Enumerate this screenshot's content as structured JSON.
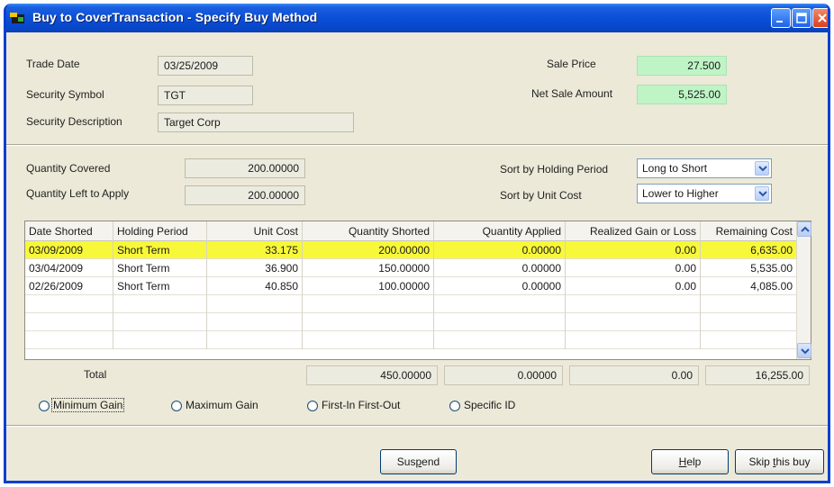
{
  "window": {
    "title": "Buy to CoverTransaction - Specify Buy Method"
  },
  "trade": {
    "trade_date_label": "Trade Date",
    "trade_date": "03/25/2009",
    "symbol_label": "Security Symbol",
    "symbol": "TGT",
    "description_label": "Security Description",
    "description": "Target Corp",
    "sale_price_label": "Sale Price",
    "sale_price": "27.500",
    "net_sale_label": "Net Sale Amount",
    "net_sale": "5,525.00"
  },
  "quantities": {
    "covered_label": "Quantity Covered",
    "covered": "200.00000",
    "left_label": "Quantity Left to Apply",
    "left": "200.00000"
  },
  "sorting": {
    "holding_label": "Sort by Holding Period",
    "holding_value": "Long to Short",
    "unit_cost_label": "Sort by Unit Cost",
    "unit_cost_value": "Lower to Higher"
  },
  "table": {
    "headers": [
      "Date Shorted",
      "Holding Period",
      "Unit Cost",
      "Quantity Shorted",
      "Quantity Applied",
      "Realized Gain or Loss",
      "Remaining Cost"
    ],
    "rows": [
      [
        "03/09/2009",
        "Short Term",
        "33.175",
        "200.00000",
        "0.00000",
        "0.00",
        "6,635.00"
      ],
      [
        "03/04/2009",
        "Short Term",
        "36.900",
        "150.00000",
        "0.00000",
        "0.00",
        "5,535.00"
      ],
      [
        "02/26/2009",
        "Short Term",
        "40.850",
        "100.00000",
        "0.00000",
        "0.00",
        "4,085.00"
      ]
    ],
    "selected_row": 0
  },
  "totals": {
    "label": "Total",
    "quantity_shorted": "450.00000",
    "quantity_applied": "0.00000",
    "realized": "0.00",
    "remaining": "16,255.00"
  },
  "methods": {
    "minimum": "Minimum Gain",
    "maximum": "Maximum Gain",
    "fifo": "First-In First-Out",
    "specific": "Specific ID"
  },
  "buttons": {
    "suspend_pre": "Sus",
    "suspend_key": "p",
    "suspend_post": "end",
    "help_key": "H",
    "help_post": "elp",
    "skip_pre": "Skip ",
    "skip_key": "t",
    "skip_post": "his buy"
  },
  "colors": {
    "selected_row": "#f8f83a",
    "price_field": "#bff5c6",
    "titlebar": "#0a4fd6"
  },
  "icons": [
    "app-icon",
    "minimize-icon",
    "maximize-icon",
    "close-icon",
    "chevron-down-icon",
    "scroll-up-icon",
    "scroll-down-icon"
  ]
}
